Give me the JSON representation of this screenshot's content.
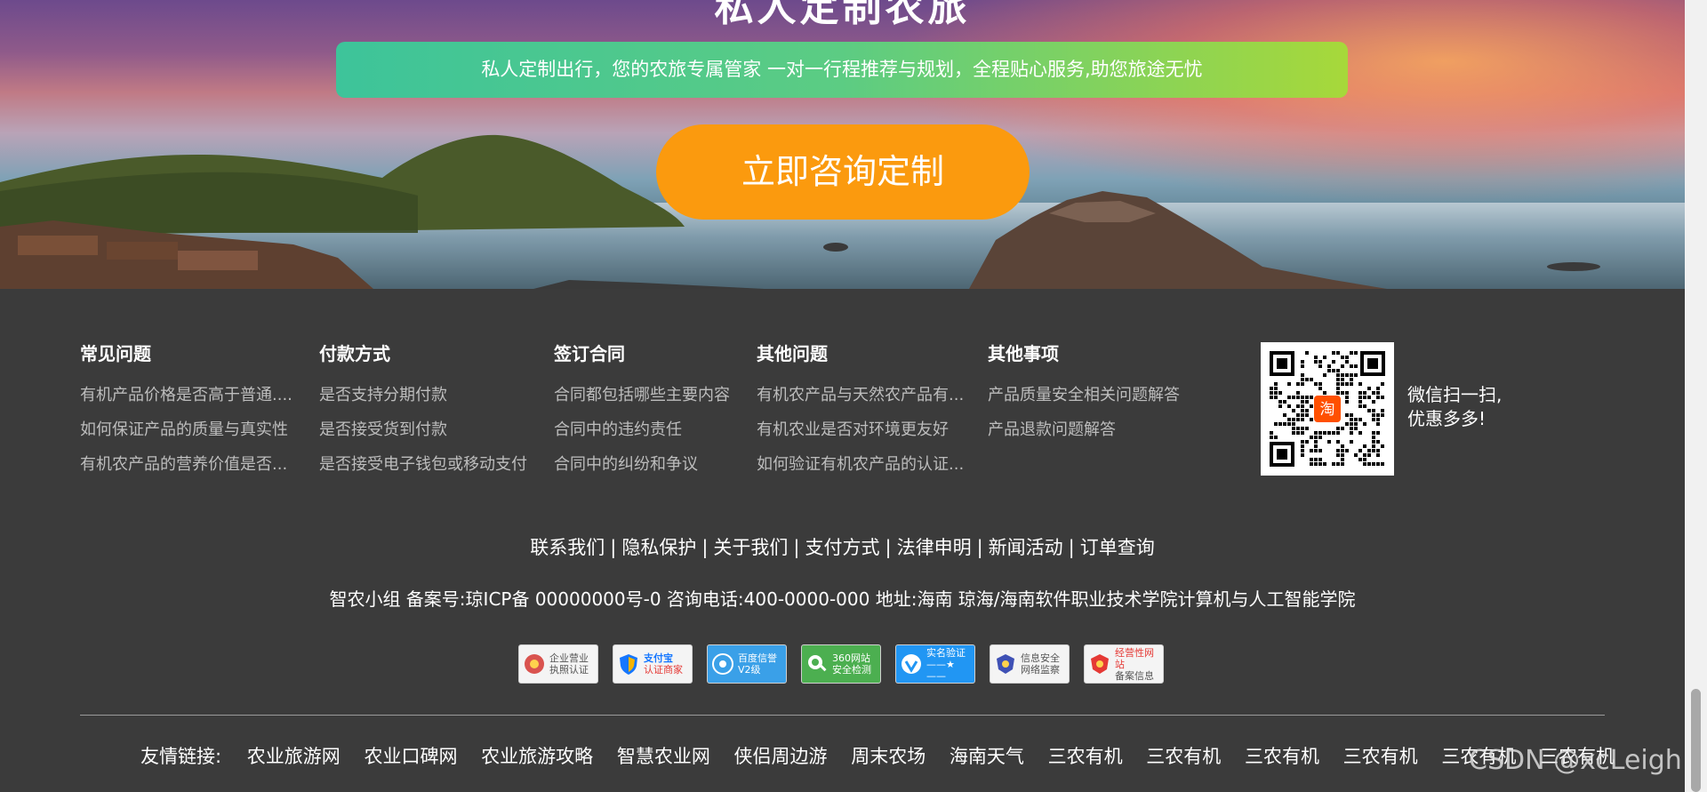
{
  "hero": {
    "title": "私人定制农旅",
    "slogan": "私人定制出行，您的农旅专属管家 一对一行程推荐与规划，全程贴心服务,助您旅途无忧",
    "cta_label": "立即咨询定制"
  },
  "faq": {
    "columns": [
      {
        "title": "常见问题",
        "items": [
          "有机产品价格是否高于普通....",
          "如何保证产品的质量与真实性",
          "有机农产品的营养价值是否..."
        ]
      },
      {
        "title": "付款方式",
        "items": [
          "是否支持分期付款",
          "是否接受货到付款",
          "是否接受电子钱包或移动支付"
        ]
      },
      {
        "title": "签订合同",
        "items": [
          "合同都包括哪些主要内容",
          "合同中的违约责任",
          "合同中的纠纷和争议"
        ]
      },
      {
        "title": "其他问题",
        "items": [
          "有机农产品与天然农产品有...",
          "有机农业是否对环境更友好",
          "如何验证有机农产品的认证..."
        ]
      },
      {
        "title": "其他事项",
        "items": [
          "产品质量安全相关问题解答",
          "产品退款问题解答"
        ]
      }
    ]
  },
  "qr": {
    "center_label": "淘",
    "line1": "微信扫一扫,",
    "line2": "优惠多多!"
  },
  "footer_links": [
    "联系我们",
    "隐私保护",
    "关于我们",
    "支付方式",
    "法律申明",
    "新闻活动",
    "订单查询"
  ],
  "footer_separator": "|",
  "icp_text": "智农小组 备案号:琼ICP备 00000000号-0 咨询电话:400-0000-000 地址:海南 琼海/海南软件职业技术学院计算机与人工智能学院",
  "badges": [
    {
      "line1": "企业营业",
      "line2": "执照认证",
      "icon": "business-license-icon",
      "color": "#d9534f"
    },
    {
      "line1": "支付宝",
      "line2": "认证商家",
      "icon": "alipay-shield-icon",
      "color": "#1677ff"
    },
    {
      "line1": "百度信誉",
      "line2": "V2级",
      "icon": "baidu-credit-icon",
      "color": "#3aa0e8"
    },
    {
      "line1": "360网站",
      "line2": "安全检测",
      "icon": "360-security-icon",
      "color": "#4caf50"
    },
    {
      "line1": "实名验证",
      "line2": "——★——",
      "icon": "realname-verify-icon",
      "color": "#2196f3"
    },
    {
      "line1": "信息安全",
      "line2": "网络监察",
      "icon": "police-badge-icon",
      "color": "#3f51b5"
    },
    {
      "line1": "经营性网站",
      "line2": "备案信息",
      "icon": "record-info-icon",
      "color": "#e53935"
    }
  ],
  "friend_links": {
    "label": "友情链接:",
    "items": [
      "农业旅游网",
      "农业口碑网",
      "农业旅游攻略",
      "智慧农业网",
      "侠侣周边游",
      "周末农场",
      "海南天气",
      "三农有机",
      "三农有机",
      "三农有机",
      "三农有机",
      "三农有机",
      "三农有机"
    ]
  },
  "watermark": "CSDN @xcLeigh"
}
